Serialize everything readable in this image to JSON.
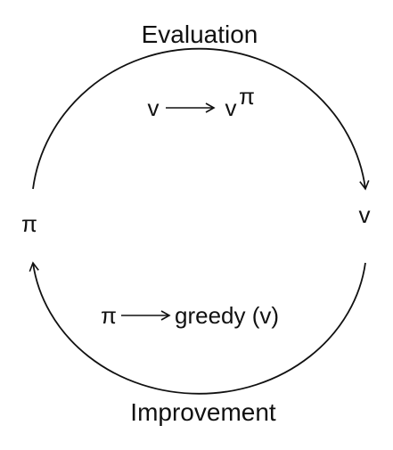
{
  "diagram": {
    "top_label": "Evaluation",
    "bottom_label": "Improvement",
    "top_expr": {
      "from": "v",
      "to_base": "v",
      "to_superscript": "π"
    },
    "bottom_expr": {
      "from": "π",
      "to": "greedy (v)"
    },
    "left_node": "π",
    "right_node": "v"
  },
  "colors": {
    "stroke": "#111111",
    "background": "#ffffff"
  }
}
